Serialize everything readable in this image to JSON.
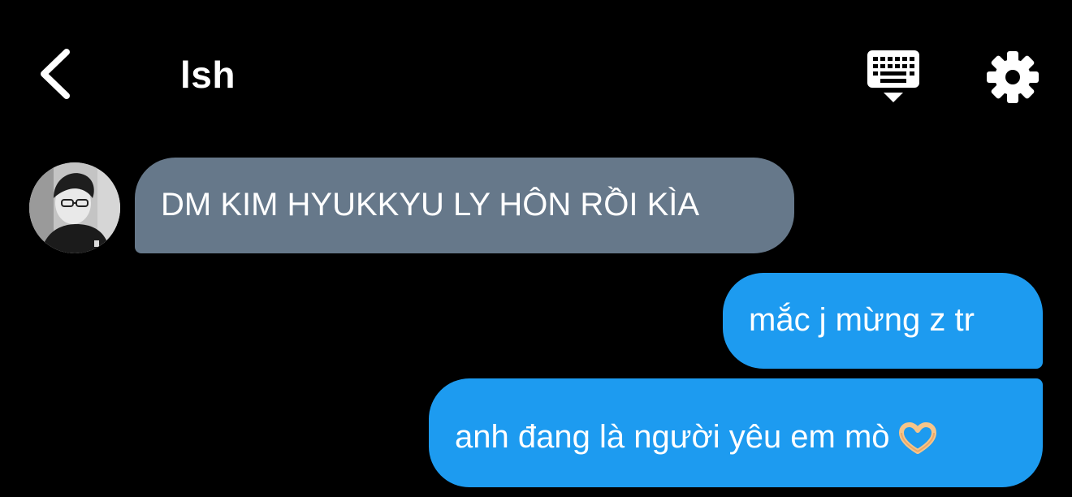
{
  "header": {
    "title": "lsh",
    "back_icon": "chevron-left-icon",
    "keyboard_icon": "keyboard-icon",
    "settings_icon": "gear-icon"
  },
  "messages": [
    {
      "direction": "incoming",
      "text": "DM KIM HYUKKYU LY HÔN RỒI KÌA",
      "color": "#66788a"
    },
    {
      "direction": "outgoing",
      "text": "mắc j mừng z tr",
      "color": "#1d9bf0"
    },
    {
      "direction": "outgoing",
      "text": "anh đang là người yêu em mò",
      "emoji": "heart-hands-emoji",
      "color": "#1d9bf0"
    }
  ],
  "colors": {
    "background": "#000000",
    "incoming_bubble": "#66788a",
    "outgoing_bubble": "#1d9bf0",
    "text": "#ffffff"
  }
}
